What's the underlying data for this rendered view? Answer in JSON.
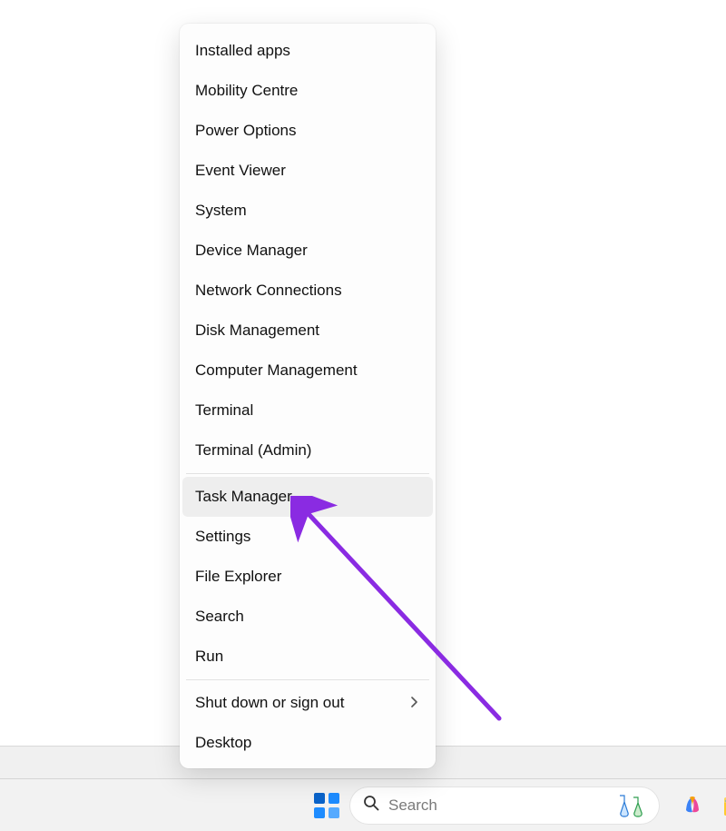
{
  "menu": {
    "items": [
      {
        "label": "Installed apps"
      },
      {
        "label": "Mobility Centre"
      },
      {
        "label": "Power Options"
      },
      {
        "label": "Event Viewer"
      },
      {
        "label": "System"
      },
      {
        "label": "Device Manager"
      },
      {
        "label": "Network Connections"
      },
      {
        "label": "Disk Management"
      },
      {
        "label": "Computer Management"
      },
      {
        "label": "Terminal"
      },
      {
        "label": "Terminal (Admin)"
      },
      {
        "label": "Task Manager"
      },
      {
        "label": "Settings"
      },
      {
        "label": "File Explorer"
      },
      {
        "label": "Search"
      },
      {
        "label": "Run"
      },
      {
        "label": "Shut down or sign out"
      },
      {
        "label": "Desktop"
      }
    ],
    "highlighted_index": 11,
    "separators_before": [
      11,
      16
    ],
    "submenu_indices": [
      16
    ]
  },
  "taskbar": {
    "search_placeholder": "Search"
  },
  "annotation": {
    "color": "#8a2be2"
  }
}
